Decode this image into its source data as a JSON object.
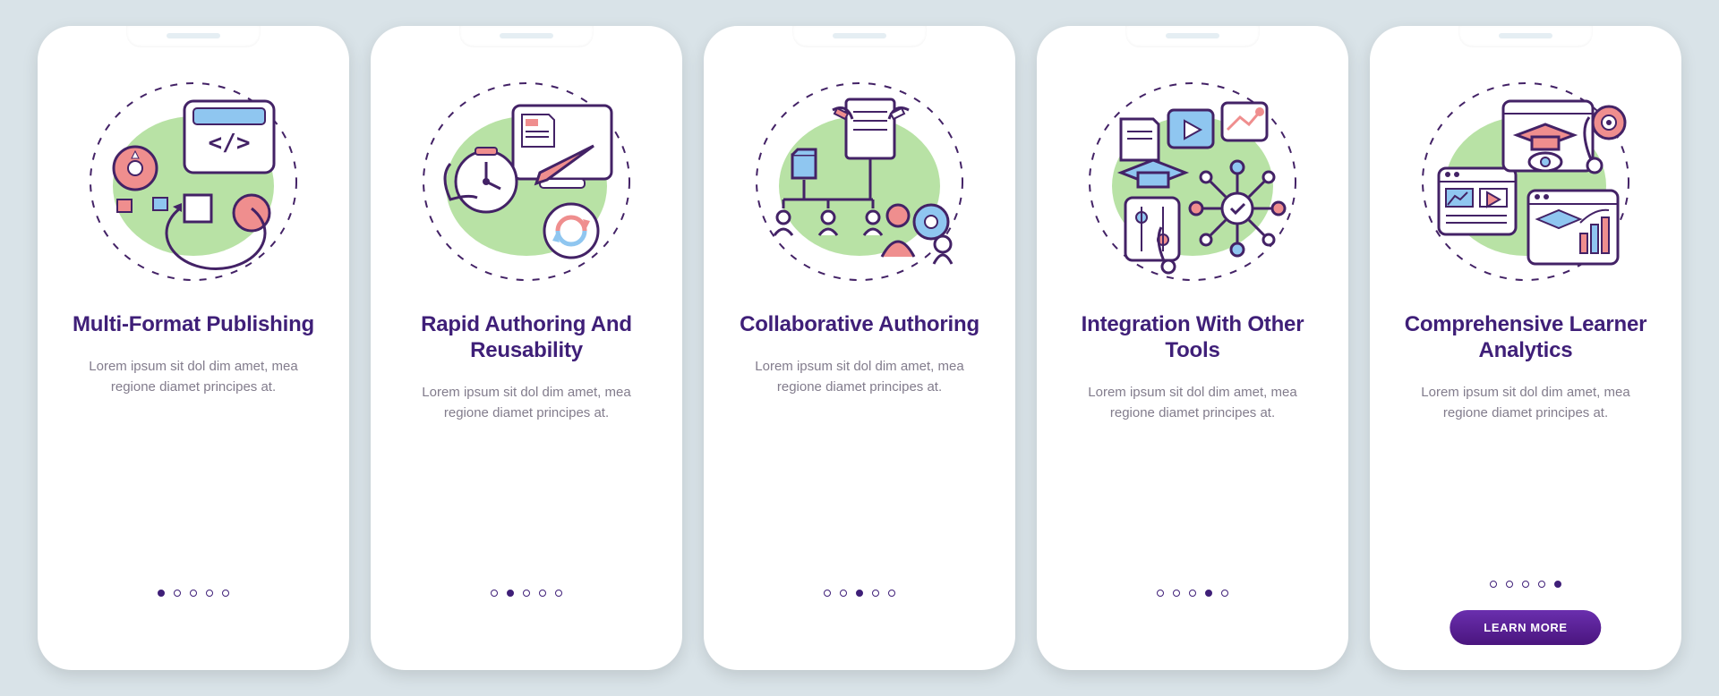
{
  "colors": {
    "background": "#d9e3e8",
    "card": "#ffffff",
    "heading": "#3f1f78",
    "body_text": "#827c8c",
    "dot_stroke": "#3f1f78",
    "cta_gradient_top": "#6a2fae",
    "cta_gradient_bottom": "#4a157e",
    "accent_green": "#b8e2a5",
    "accent_coral": "#ef8e8e",
    "accent_blue": "#8fc6f0",
    "stroke_purple": "#432266"
  },
  "dot_count": 5,
  "cards": [
    {
      "icon_name": "multi-format-publishing-icon",
      "title": "Multi-Format Publishing",
      "body": "Lorem ipsum sit dol dim amet, mea regione diamet principes at.",
      "active_index": 0,
      "has_cta": false
    },
    {
      "icon_name": "rapid-authoring-reusability-icon",
      "title": "Rapid Authoring And Reusability",
      "body": "Lorem ipsum sit dol dim amet, mea regione diamet principes at.",
      "active_index": 1,
      "has_cta": false
    },
    {
      "icon_name": "collaborative-authoring-icon",
      "title": "Collaborative Authoring",
      "body": "Lorem ipsum sit dol dim amet, mea regione diamet principes at.",
      "active_index": 2,
      "has_cta": false
    },
    {
      "icon_name": "integration-other-tools-icon",
      "title": "Integration With Other Tools",
      "body": "Lorem ipsum sit dol dim amet, mea regione diamet principes at.",
      "active_index": 3,
      "has_cta": false
    },
    {
      "icon_name": "comprehensive-learner-analytics-icon",
      "title": "Comprehensive Learner Analytics",
      "body": "Lorem ipsum sit dol dim amet, mea regione diamet principes at.",
      "active_index": 4,
      "has_cta": true,
      "cta_label": "LEARN MORE"
    }
  ]
}
